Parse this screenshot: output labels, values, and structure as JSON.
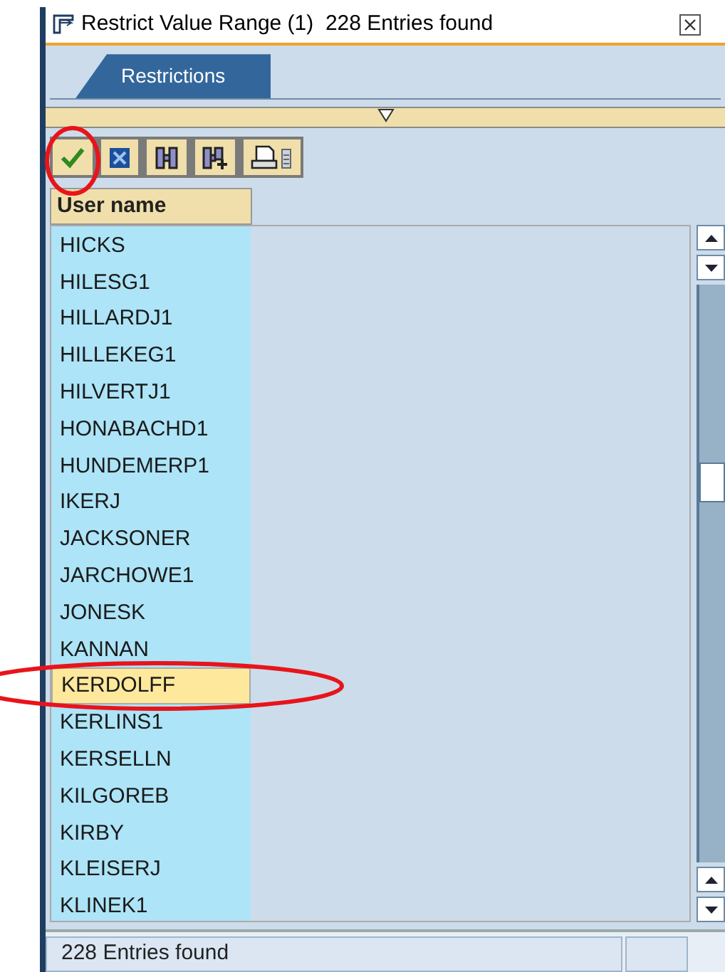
{
  "window": {
    "title": "Restrict Value Range (1)  228 Entries found"
  },
  "tabs": [
    {
      "label": "Restrictions",
      "selected": true
    }
  ],
  "toolbar": [
    {
      "kind": "check"
    },
    {
      "kind": "cancel"
    },
    {
      "kind": "find"
    },
    {
      "kind": "find-next"
    },
    {
      "kind": "print"
    }
  ],
  "table": {
    "columns": [
      "User name"
    ],
    "rows": [
      {
        "user": "HICKS",
        "selected": false
      },
      {
        "user": "HILESG1",
        "selected": false
      },
      {
        "user": "HILLARDJ1",
        "selected": false
      },
      {
        "user": "HILLEKEG1",
        "selected": false
      },
      {
        "user": "HILVERTJ1",
        "selected": false
      },
      {
        "user": "HONABACHD1",
        "selected": false
      },
      {
        "user": "HUNDEMERP1",
        "selected": false
      },
      {
        "user": "IKERJ",
        "selected": false
      },
      {
        "user": "JACKSONER",
        "selected": false
      },
      {
        "user": "JARCHOWE1",
        "selected": false
      },
      {
        "user": "JONESK",
        "selected": false
      },
      {
        "user": "KANNAN",
        "selected": false
      },
      {
        "user": "KERDOLFF",
        "selected": true
      },
      {
        "user": "KERLINS1",
        "selected": false
      },
      {
        "user": "KERSELLN",
        "selected": false
      },
      {
        "user": "KILGOREB",
        "selected": false
      },
      {
        "user": "KIRBY",
        "selected": false
      },
      {
        "user": "KLEISERJ",
        "selected": false
      },
      {
        "user": "KLINEK1",
        "selected": false
      }
    ]
  },
  "status_bar": {
    "text": "228 Entries found"
  }
}
